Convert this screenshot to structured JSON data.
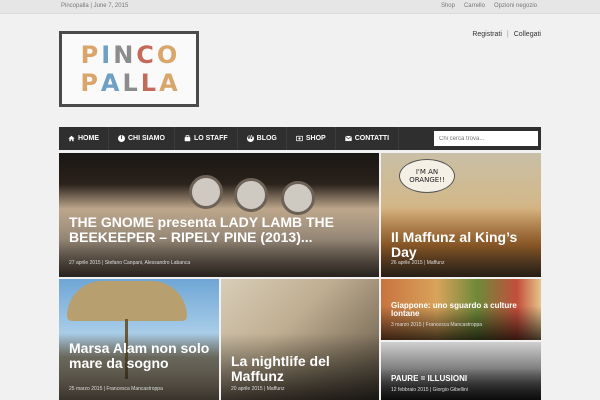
{
  "topbar": {
    "site_date": "Pincopalla | June 7, 2015",
    "links": [
      "Shop",
      "Carrello",
      "Opzioni negozio"
    ]
  },
  "logo": {
    "line1": [
      "P",
      "I",
      "N",
      "C",
      "O"
    ],
    "line2": [
      "P",
      "A",
      "L",
      "L",
      "A"
    ]
  },
  "account": {
    "register": "Registrati",
    "separator": "|",
    "login": "Collegati"
  },
  "nav": {
    "items": [
      {
        "label": "HOME",
        "icon": "home-icon"
      },
      {
        "label": "CHI SIAMO",
        "icon": "info-icon"
      },
      {
        "label": "LO STAFF",
        "icon": "staff-icon"
      },
      {
        "label": "BLOG",
        "icon": "wordpress-icon"
      },
      {
        "label": "SHOP",
        "icon": "shop-icon"
      },
      {
        "label": "CONTATTI",
        "icon": "mail-icon"
      }
    ],
    "search_placeholder": "Chi cerca trova..."
  },
  "tiles": [
    {
      "title": "THE GNOME presenta LADY LAMB THE BEEKEEPER – RIPELY PINE (2013)...",
      "meta": "27 aprile 2015 | Stefano Canpani, Alessandro Labanca"
    },
    {
      "title": "Il Maffunz al King’s Day",
      "meta": "26 aprile 2015 | Maffunz"
    },
    {
      "title": "Marsa Alam non solo mare da sogno",
      "meta": "25 marzo 2015 | Francesca Mancastroppa"
    },
    {
      "title": "La nightlife del Maffunz",
      "meta": "20 aprile 2015 | Maffunz"
    },
    {
      "title": "Giappone: uno sguardo a culture lontane",
      "meta": "3 marzo 2015 | Francesca Mancastroppa"
    },
    {
      "title": "PAURE = ILLUSIONI",
      "meta": "12 febbraio 2015 | Giorgio Gibellini"
    }
  ],
  "image_text": {
    "orange_bubble": "I'M AN ORANGE!!"
  },
  "colors": {
    "nav_bg": "#2f2f2f",
    "page_bg": "#f1f1f1",
    "topbar_bg": "#e6e6e6"
  }
}
